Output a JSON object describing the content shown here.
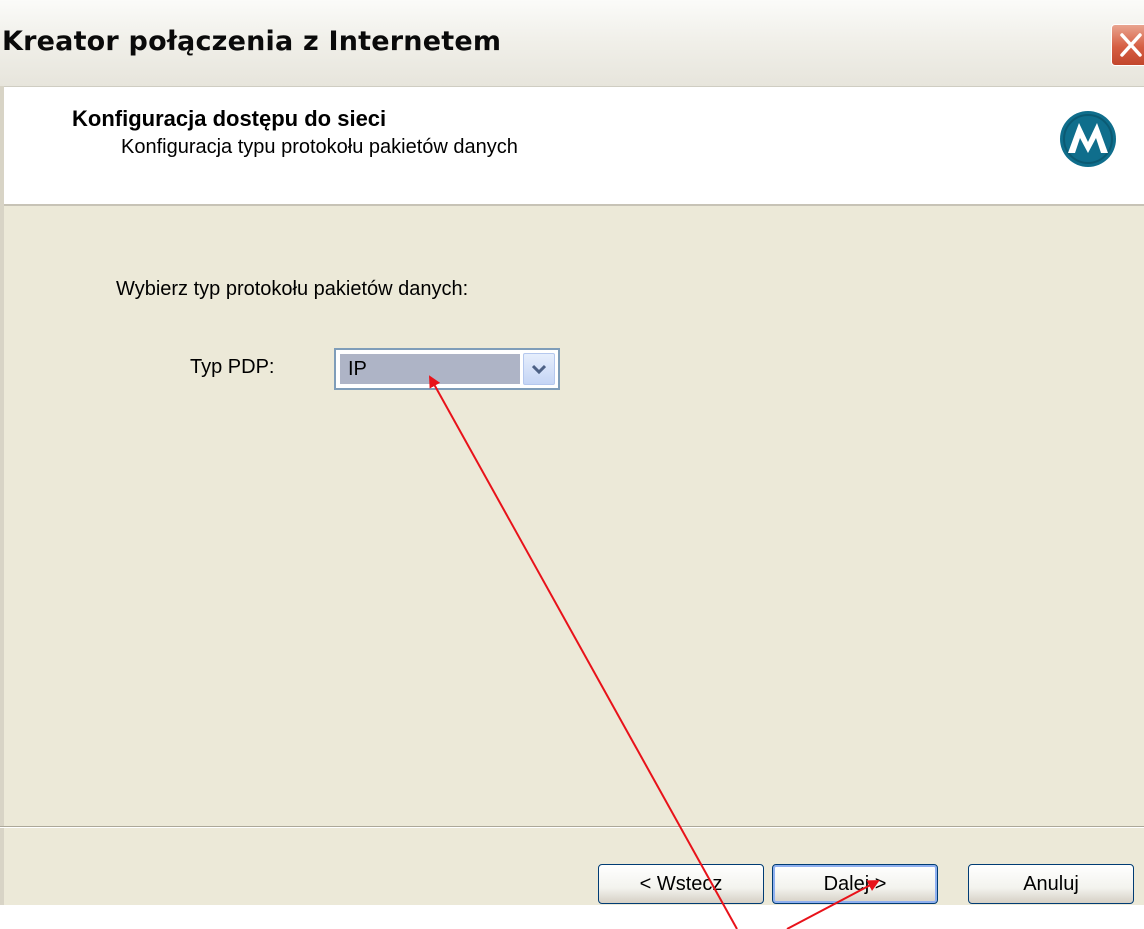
{
  "window": {
    "title": "Kreator połączenia z Internetem"
  },
  "header": {
    "title": "Konfiguracja dostępu do sieci",
    "subtitle": "Konfiguracja typu protokołu pakietów danych",
    "logo_icon": "motorola-logo-icon"
  },
  "content": {
    "prompt": "Wybierz typ protokołu pakietów danych:",
    "pdp_label": "Typ PDP:",
    "pdp_value": "IP"
  },
  "buttons": {
    "back": "< Wstecz",
    "next": "Dalej >",
    "cancel": "Anuluj"
  },
  "colors": {
    "annotation_arrow": "#e8121a",
    "logo": "#0f6e8c"
  }
}
